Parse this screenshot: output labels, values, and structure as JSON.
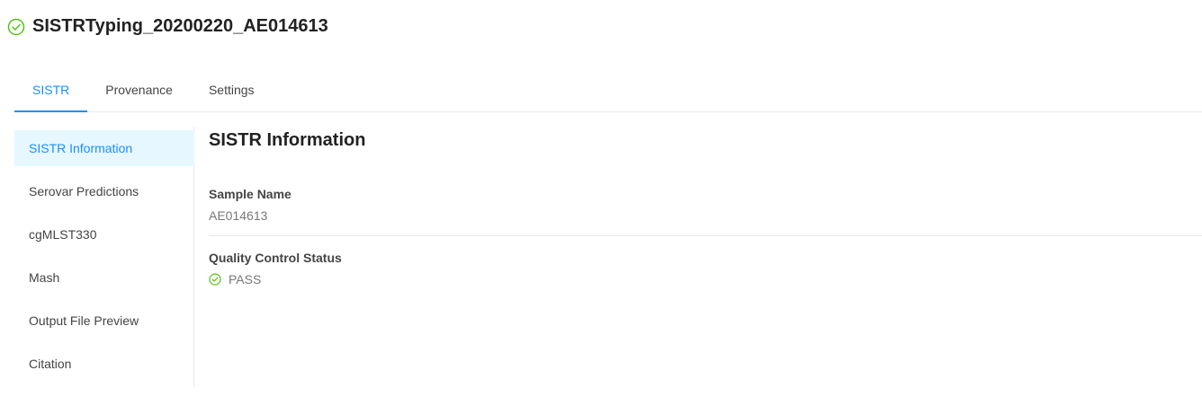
{
  "header": {
    "title": "SISTRTyping_20200220_AE014613",
    "status_icon": "check-circle-icon",
    "status_color": "#52c41a"
  },
  "tabs": [
    {
      "label": "SISTR",
      "active": true
    },
    {
      "label": "Provenance",
      "active": false
    },
    {
      "label": "Settings",
      "active": false
    }
  ],
  "sidebar": {
    "items": [
      {
        "label": "SISTR Information",
        "active": true
      },
      {
        "label": "Serovar Predictions",
        "active": false
      },
      {
        "label": "cgMLST330",
        "active": false
      },
      {
        "label": "Mash",
        "active": false
      },
      {
        "label": "Output File Preview",
        "active": false
      },
      {
        "label": "Citation",
        "active": false
      }
    ]
  },
  "main": {
    "heading": "SISTR Information",
    "sample_name_label": "Sample Name",
    "sample_name_value": "AE014613",
    "qc_label": "Quality Control Status",
    "qc_value": "PASS",
    "qc_icon": "check-circle-icon"
  },
  "colors": {
    "accent": "#1890ff",
    "success": "#52c41a"
  }
}
